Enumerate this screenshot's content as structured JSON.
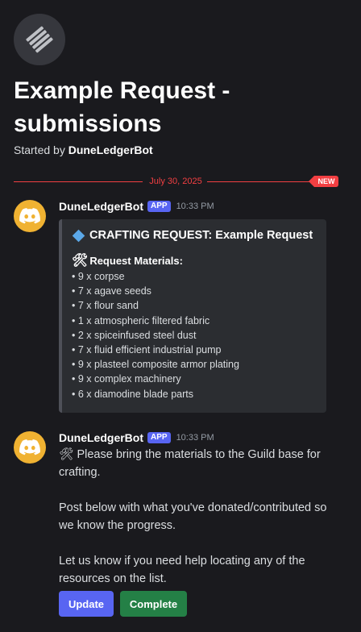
{
  "thread": {
    "title": "Example Request - submissions",
    "started_prefix": "Started by",
    "started_by": "DuneLedgerBot"
  },
  "divider": {
    "date": "July 30, 2025",
    "new_label": "NEW"
  },
  "messages": [
    {
      "author": "DuneLedgerBot",
      "tag": "APP",
      "time": "10:33 PM",
      "embed": {
        "title": "CRAFTING REQUEST: Example Request",
        "materials_heading": "Request Materials:",
        "materials": [
          "9 x corpse",
          "7 x agave seeds",
          "7 x flour sand",
          "1 x atmospheric filtered fabric",
          "2 x spiceinfused steel dust",
          "7 x fluid efficient industrial pump",
          "9 x plasteel composite armor plating",
          "9 x complex machinery",
          "6 x diamodine blade parts"
        ]
      }
    },
    {
      "author": "DuneLedgerBot",
      "tag": "APP",
      "time": "10:33 PM",
      "paragraphs": [
        "Please bring the materials to the Guild base for crafting.",
        "Post below with what you've donated/contributed so we know the progress.",
        "Let us know if you need help locating any of the resources on the list."
      ],
      "buttons": {
        "update": "Update",
        "complete": "Complete"
      }
    }
  ],
  "icons": {
    "thread": "thread-logo-icon",
    "avatar": "discord-logo-icon",
    "embed_title": "blue-diamond-icon",
    "tools": "hammer-and-wrench-icon"
  },
  "colors": {
    "background": "#1a1a1e",
    "accent_red": "#f23f42",
    "app_tag": "#5865f2",
    "avatar": "#f0b232",
    "update_button": "#5865f2",
    "complete_button": "#248046"
  }
}
